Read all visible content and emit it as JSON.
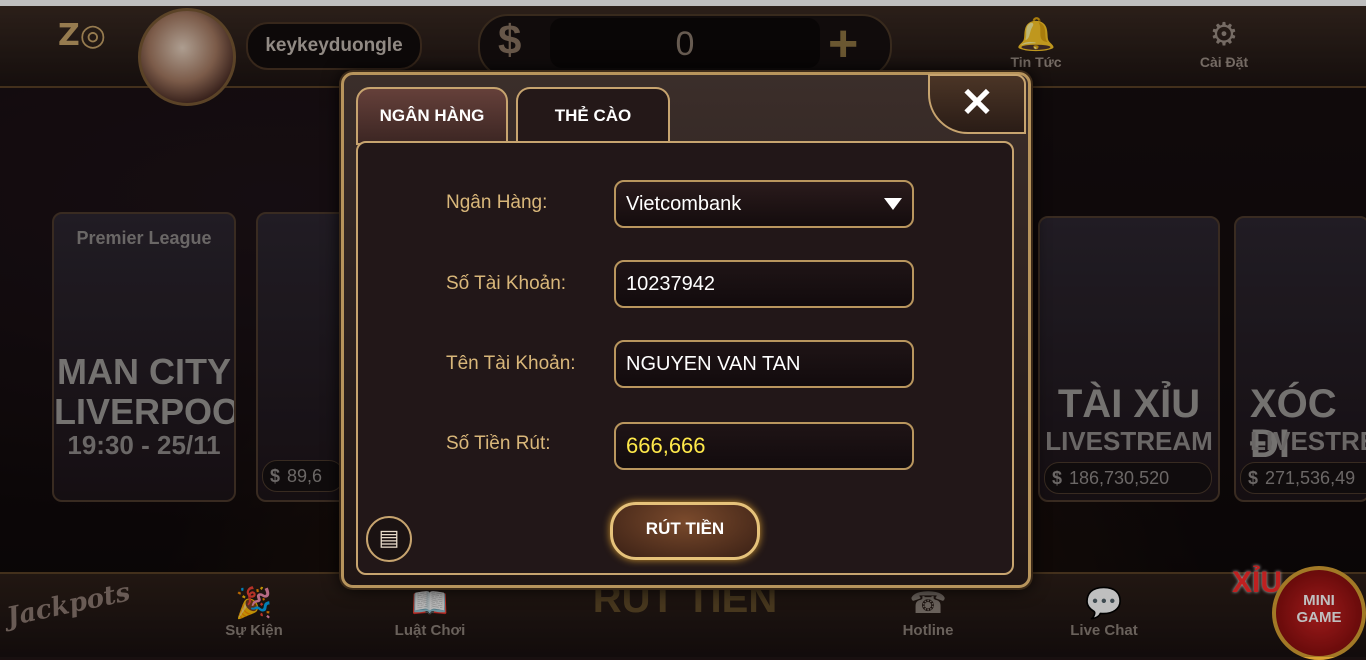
{
  "header": {
    "username": "keykeyduongle",
    "currency_symbol": "$",
    "balance": "0",
    "add_symbol": "+",
    "nav": [
      {
        "label": "Tin Tức",
        "icon": "bell-icon"
      },
      {
        "label": "Cài Đặt",
        "icon": "gear-icon"
      }
    ]
  },
  "cards": {
    "match": {
      "line1": "MAN CITY",
      "line2": "LIVERPOOL",
      "line3": "19:30 - 25/11",
      "league": "Premier League"
    },
    "slot": {
      "jackpot": "89,6"
    },
    "taixiu": {
      "line1": "TÀI XỈU",
      "line2": "LIVESTREAM",
      "jackpot": "186,730,520"
    },
    "xocdia": {
      "line1": "XÓC ĐI",
      "line2": "LIVESTREA",
      "jackpot": "271,536,49"
    }
  },
  "bottom": {
    "nav": [
      {
        "label": "Sự Kiện",
        "icon": "event-icon"
      },
      {
        "label": "Luật Chơi",
        "icon": "rules-icon"
      },
      {
        "label": "Hotline",
        "icon": "phone-icon"
      },
      {
        "label": "Live Chat",
        "icon": "chat-icon"
      }
    ],
    "center_label": "RÚT TIỀN",
    "jackpots_label": "Jackpots",
    "xiu_label": "XỈU",
    "mini_game": [
      "MINI",
      "GAME"
    ]
  },
  "modal": {
    "tabs": [
      {
        "label": "NGÂN HÀNG",
        "active": true
      },
      {
        "label": "THẺ CÀO",
        "active": false
      }
    ],
    "close_symbol": "✕",
    "form": {
      "bank_label": "Ngân Hàng:",
      "bank_value": "Vietcombank",
      "account_number_label": "Số Tài Khoản:",
      "account_number_value": "10237942",
      "account_name_label": "Tên Tài Khoản:",
      "account_name_value": "NGUYEN VAN TAN",
      "amount_label": "Số Tiền Rút:",
      "amount_value": "666,666",
      "amount_color": "#ffe94a"
    },
    "submit_label": "RÚT TIỀN",
    "accent_color": "#c7a46f"
  }
}
